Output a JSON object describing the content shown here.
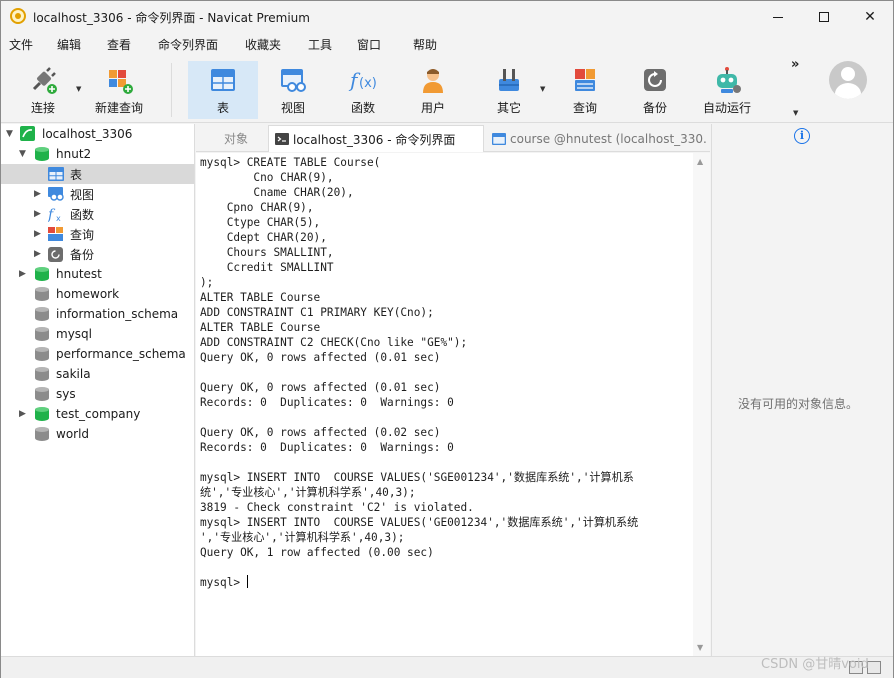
{
  "window": {
    "title": "localhost_3306 - 命令列界面 - Navicat Premium"
  },
  "menu": [
    "文件",
    "编辑",
    "查看",
    "命令列界面",
    "收藏夹",
    "工具",
    "窗口",
    "帮助"
  ],
  "toolbar": {
    "items": [
      {
        "label": "连接",
        "icon": "connection-plug-icon"
      },
      {
        "label": "新建查询",
        "icon": "new-query-icon"
      },
      {
        "label": "表",
        "icon": "table-icon",
        "active": true
      },
      {
        "label": "视图",
        "icon": "view-icon"
      },
      {
        "label": "函数",
        "icon": "function-icon"
      },
      {
        "label": "用户",
        "icon": "user-icon"
      },
      {
        "label": "其它",
        "icon": "tools-icon"
      },
      {
        "label": "查询",
        "icon": "query-icon"
      },
      {
        "label": "备份",
        "icon": "backup-icon"
      },
      {
        "label": "自动运行",
        "icon": "robot-icon"
      }
    ],
    "more": "»"
  },
  "tree": {
    "connection": "localhost_3306",
    "db_open": "hnut2",
    "children": [
      "表",
      "视图",
      "函数",
      "查询",
      "备份"
    ],
    "databases": [
      "hnutest",
      "homework",
      "information_schema",
      "mysql",
      "performance_schema",
      "sakila",
      "sys",
      "test_company",
      "world"
    ]
  },
  "tabs": {
    "objects": "对象",
    "console": "localhost_3306 - 命令列界面",
    "course": "course @hnutest (localhost_330..."
  },
  "console": {
    "lines": [
      "mysql> CREATE TABLE Course(",
      "        Cno CHAR(9),",
      "        Cname CHAR(20),",
      "    Cpno CHAR(9),",
      "    Ctype CHAR(5),",
      "    Cdept CHAR(20),",
      "    Chours SMALLINT,",
      "    Ccredit SMALLINT",
      ");",
      "ALTER TABLE Course",
      "ADD CONSTRAINT C1 PRIMARY KEY(Cno);",
      "ALTER TABLE Course",
      "ADD CONSTRAINT C2 CHECK(Cno like \"GE%\");",
      "Query OK, 0 rows affected (0.01 sec)",
      "",
      "Query OK, 0 rows affected (0.01 sec)",
      "Records: 0  Duplicates: 0  Warnings: 0",
      "",
      "Query OK, 0 rows affected (0.02 sec)",
      "Records: 0  Duplicates: 0  Warnings: 0",
      "",
      "mysql> INSERT INTO  COURSE VALUES('SGE001234','数据库系统','计算机系",
      "统','专业核心','计算机科学系',40,3);",
      "3819 - Check constraint 'C2' is violated.",
      "mysql> INSERT INTO  COURSE VALUES('GE001234','数据库系统','计算机系统",
      "','专业核心','计算机科学系',40,3);",
      "Query OK, 1 row affected (0.00 sec)",
      "",
      "mysql> "
    ]
  },
  "info_panel": {
    "empty_text": "没有可用的对象信息。"
  },
  "watermark": "CSDN @甘晴void",
  "colors": {
    "db_green": "#1fb24a",
    "db_grey": "#8c8c8c",
    "active_tool": "#d7e8f7",
    "info_blue": "#1a73e8"
  }
}
